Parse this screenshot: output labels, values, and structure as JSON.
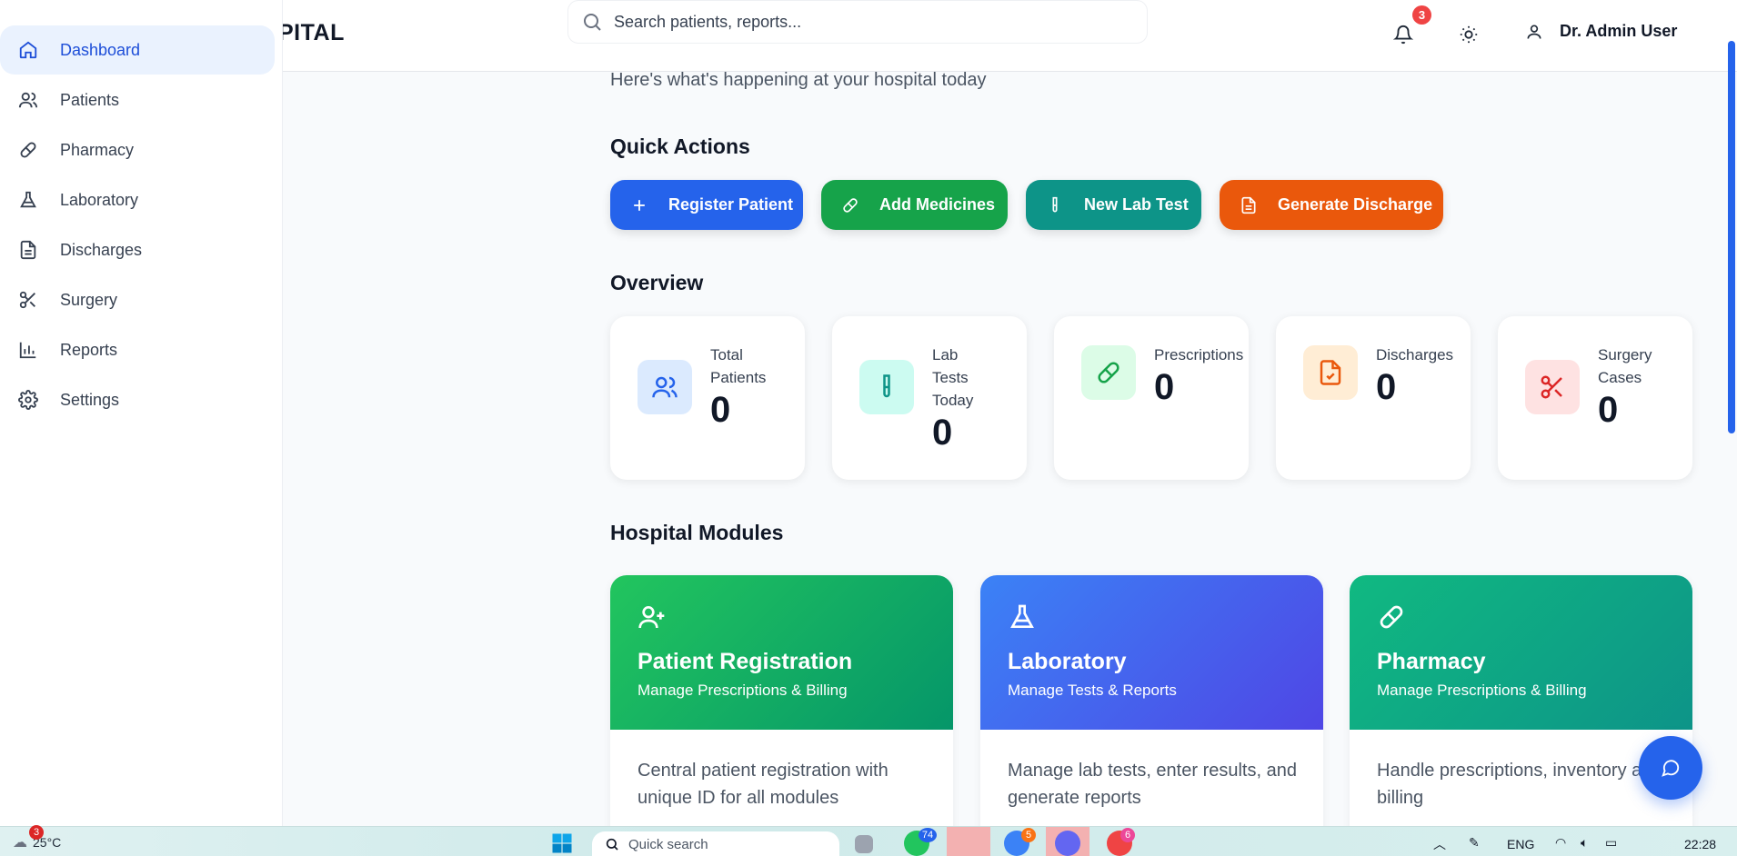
{
  "header": {
    "brand": "PITAL",
    "search_placeholder": "Search patients, reports...",
    "notification_count": "3",
    "user_name": "Dr. Admin User"
  },
  "sidebar": {
    "items": [
      {
        "label": "Dashboard",
        "icon": "home-icon",
        "active": true
      },
      {
        "label": "Patients",
        "icon": "users-icon"
      },
      {
        "label": "Pharmacy",
        "icon": "pill-icon"
      },
      {
        "label": "Laboratory",
        "icon": "flask-icon"
      },
      {
        "label": "Discharges",
        "icon": "file-icon"
      },
      {
        "label": "Surgery",
        "icon": "scissors-icon"
      },
      {
        "label": "Reports",
        "icon": "bar-chart-icon"
      },
      {
        "label": "Settings",
        "icon": "gear-icon"
      }
    ]
  },
  "main": {
    "subtitle": "Here's what's happening at your hospital today",
    "quick_actions_title": "Quick Actions",
    "quick_actions": [
      {
        "label": "Register Patient",
        "color": "#2563eb"
      },
      {
        "label": "Add Medicines",
        "color": "#16a34a"
      },
      {
        "label": "New Lab Test",
        "color": "#0d9488"
      },
      {
        "label": "Generate Discharge",
        "color": "#ea580c"
      }
    ],
    "overview_title": "Overview",
    "stats": [
      {
        "label": "Total Patients",
        "value": "0"
      },
      {
        "label": "Lab Tests Today",
        "value": "0"
      },
      {
        "label": "Prescriptions",
        "value": "0"
      },
      {
        "label": "Discharges",
        "value": "0"
      },
      {
        "label": "Surgery Cases",
        "value": "0"
      }
    ],
    "modules_title": "Hospital Modules",
    "modules": [
      {
        "title": "Patient Registration",
        "subtitle": "Manage Prescriptions & Billing",
        "description": "Central patient registration with unique ID for all modules"
      },
      {
        "title": "Laboratory",
        "subtitle": "Manage Tests & Reports",
        "description": "Manage lab tests, enter results, and generate reports"
      },
      {
        "title": "Pharmacy",
        "subtitle": "Manage Prescriptions & Billing",
        "description": "Handle prescriptions, inventory and billing"
      }
    ]
  },
  "taskbar": {
    "weather_badge": "3",
    "temperature": "25°C",
    "search_placeholder": "Quick search",
    "whatsapp_badge": "74",
    "chrome_badge": "5",
    "chrome2_badge": "6",
    "language": "ENG",
    "time": "22:28"
  }
}
